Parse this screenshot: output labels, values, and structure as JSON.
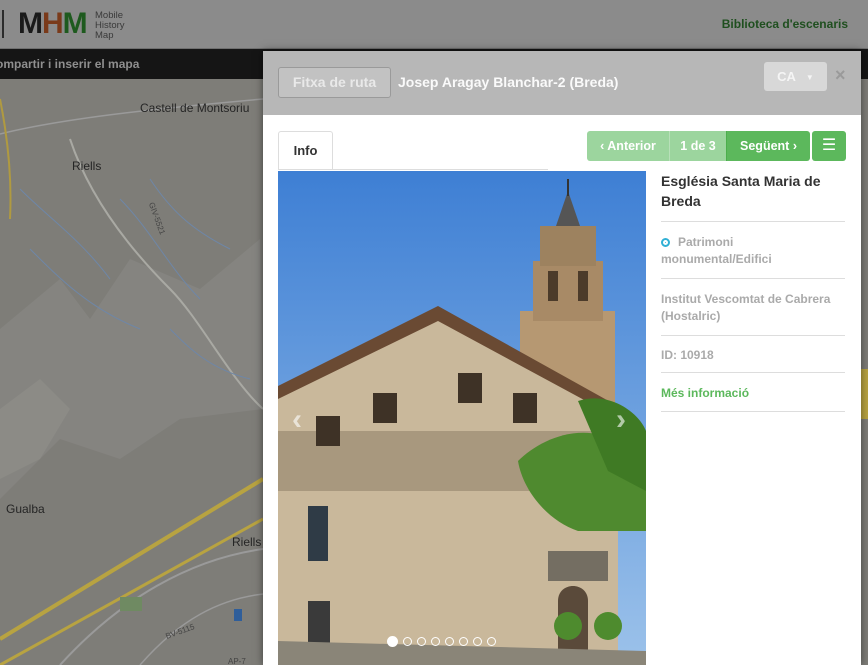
{
  "header": {
    "logo_letters": [
      "M",
      "H",
      "M"
    ],
    "logo_subtitle": [
      "Mobile",
      "History",
      "Map"
    ],
    "library_link": "Biblioteca d'escenaris"
  },
  "sharebar": {
    "label": "ompartir i inserir el mapa"
  },
  "map": {
    "places": [
      "Castell de Montsoriu",
      "Riells",
      "Gualba",
      "Riells"
    ],
    "roads": [
      "GIV-5521",
      "BV-5115",
      "AP-7"
    ]
  },
  "modal": {
    "route_button": "Fitxa de ruta",
    "title": "Josep Aragay Blanchar-2 (Breda)",
    "language": "CA",
    "close": "×",
    "tabs": [
      "Info"
    ],
    "pager": {
      "prev": "Anterior",
      "count": "1 de 3",
      "next": "Següent"
    },
    "carousel": {
      "total": 8,
      "active": 1
    },
    "info": {
      "name": "Església Santa Maria de Breda",
      "category": "Patrimoni monumental/Edifici",
      "institution": "Institut Vescomtat de Cabrera (Hostalric)",
      "id": "ID: 10918",
      "more": "Més informació"
    }
  },
  "colors": {
    "accent_green": "#5cb85c",
    "accent_green_disabled": "#9cd59e",
    "info_blue": "#31b0d5",
    "overlay_header": "#b7b7b7"
  }
}
